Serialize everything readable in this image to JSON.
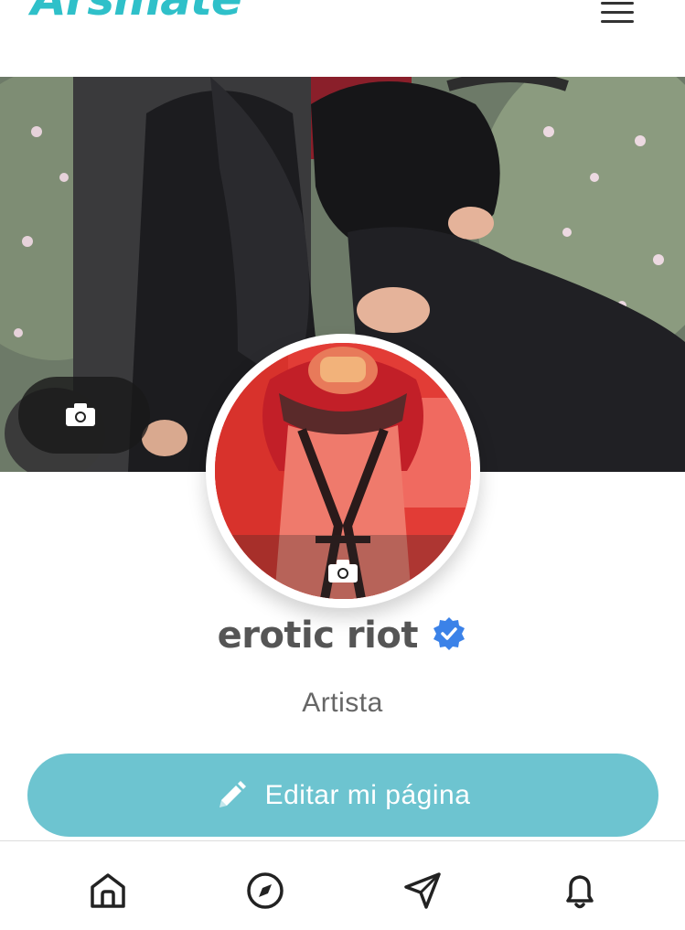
{
  "header": {
    "logo_text": "Arsmate",
    "menu_icon": "hamburger-menu-icon"
  },
  "cover": {
    "change_photo_icon": "camera-icon"
  },
  "profile": {
    "avatar_change_icon": "camera-icon",
    "name": "erotic riot",
    "verified_icon": "verified-badge-icon",
    "role": "Artista"
  },
  "actions": {
    "edit_label": "Editar mi página",
    "edit_icon": "pencil-icon"
  },
  "bottom_nav": {
    "items": [
      {
        "icon": "home-icon"
      },
      {
        "icon": "compass-icon"
      },
      {
        "icon": "send-icon"
      },
      {
        "icon": "bell-icon"
      }
    ]
  },
  "colors": {
    "brand": "#2fc0c9",
    "button": "#6dc4d0",
    "verified": "#3b82e8"
  }
}
